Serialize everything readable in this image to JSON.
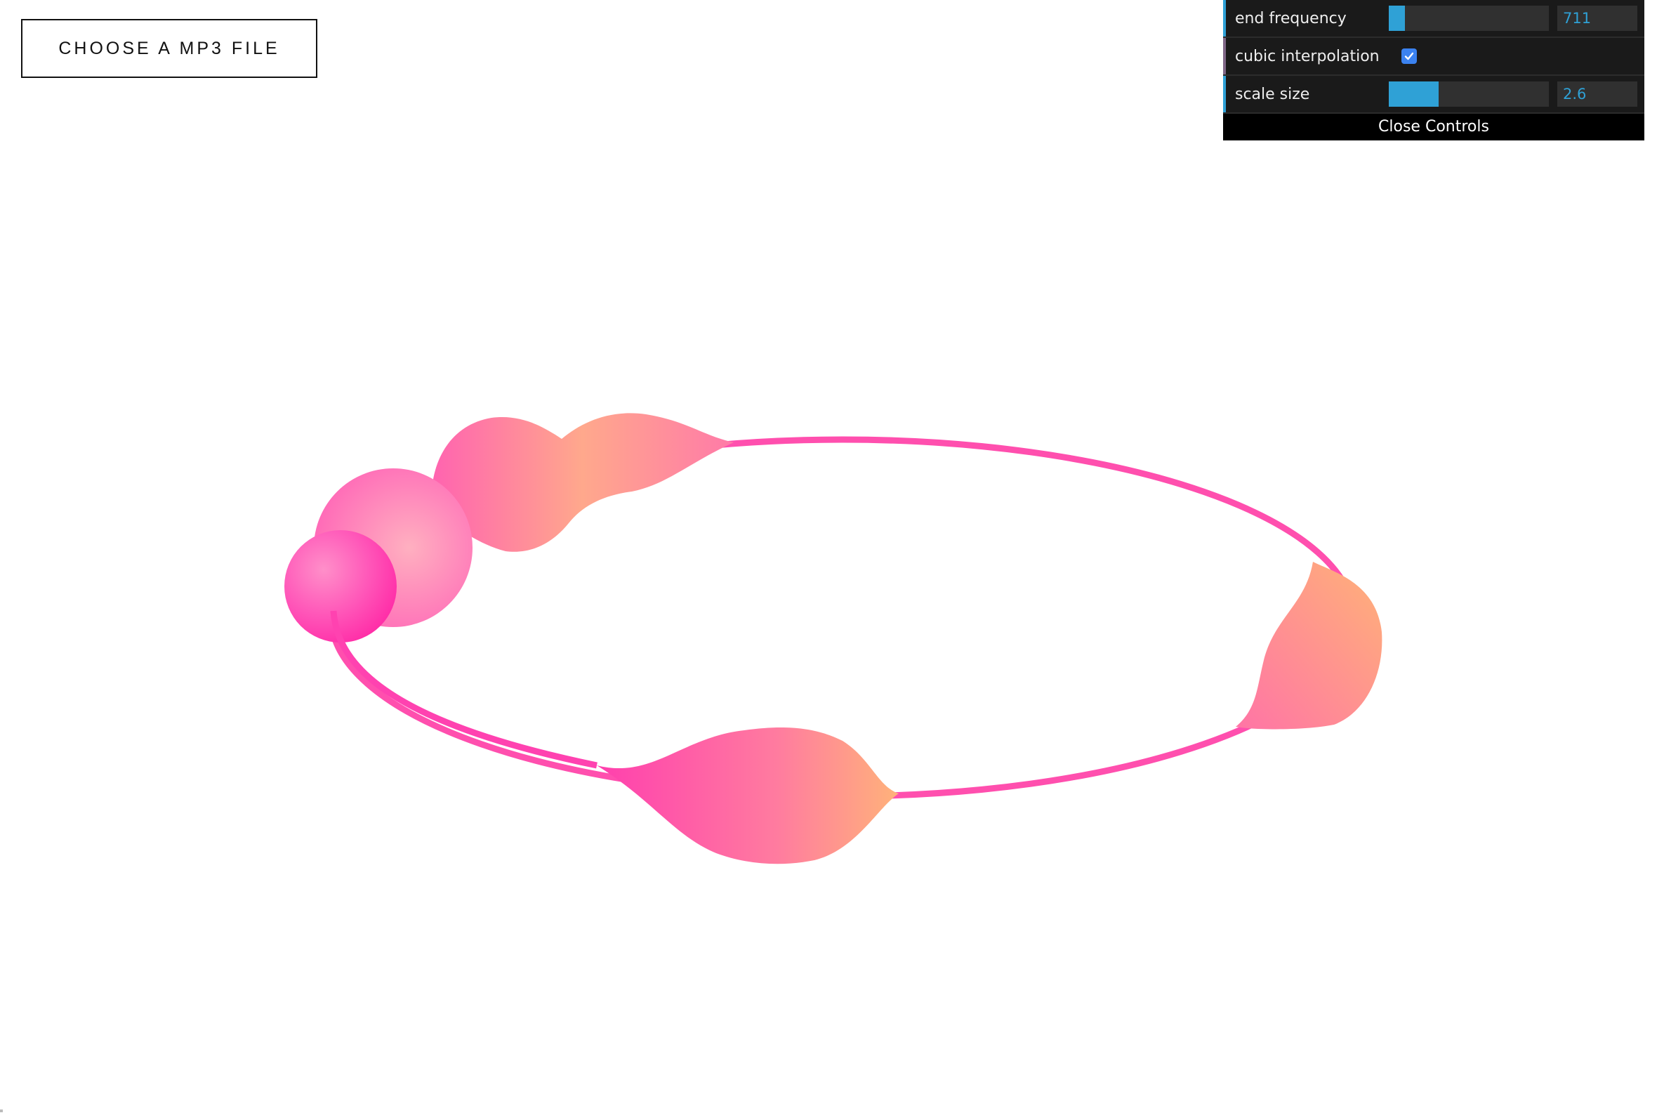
{
  "file_button": {
    "label": "CHOOSE A MP3 FILE"
  },
  "controls": {
    "rows": [
      {
        "label": "end frequency",
        "type": "slider",
        "value": "711",
        "fill_fraction": 0.1,
        "stripe_color": "#2fa1d6"
      },
      {
        "label": "cubic interpolation",
        "type": "checkbox",
        "checked": true,
        "stripe_color": "#806787"
      },
      {
        "label": "scale size",
        "type": "slider",
        "value": "2.6",
        "fill_fraction": 0.31,
        "stripe_color": "#2fa1d6"
      }
    ],
    "close_label": "Close Controls"
  },
  "colors": {
    "accent": "#2fa1d6",
    "panel_bg": "#1a1a1a",
    "ring_pink": "#ff4fae",
    "ring_peach": "#ffac7d"
  },
  "visualization": {
    "name": "audio-ring-visualizer"
  }
}
